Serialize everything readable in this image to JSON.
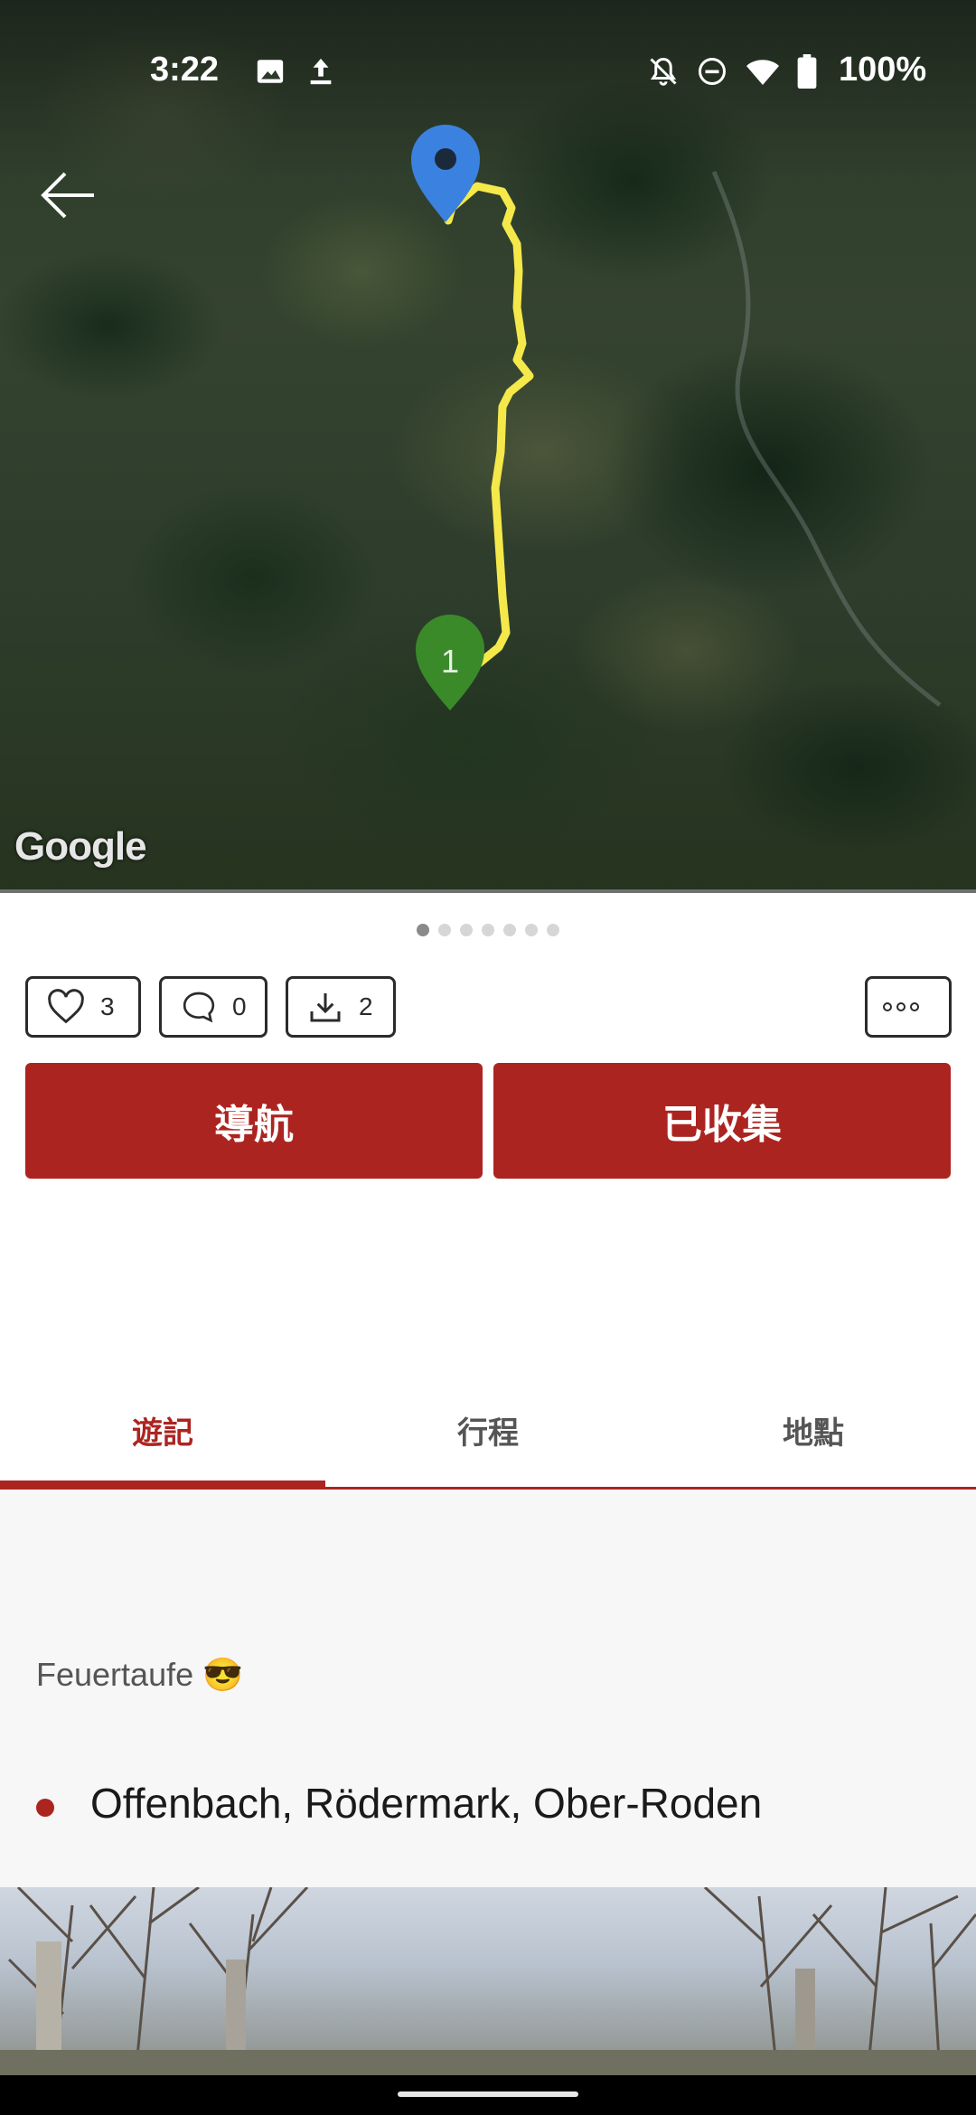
{
  "status_bar": {
    "time": "3:22",
    "battery": "100%",
    "left_icons": [
      "image-icon",
      "upload-icon"
    ],
    "right_icons": [
      "bell-off-icon",
      "do-not-disturb-icon",
      "wifi-icon",
      "battery-icon"
    ]
  },
  "map": {
    "provider": "Google",
    "start_marker_label": "1",
    "route_color": "#f5e84a",
    "start_marker_color": "#3a8a2a",
    "end_marker_color": "#3b82e0"
  },
  "carousel": {
    "count": 7,
    "active": 0
  },
  "actions": {
    "like_count": "3",
    "comment_count": "0",
    "download_count": "2"
  },
  "buttons": {
    "navigate": "導航",
    "saved": "已收集"
  },
  "tabs": [
    {
      "label": "遊記",
      "active": true
    },
    {
      "label": "行程",
      "active": false
    },
    {
      "label": "地點",
      "active": false
    }
  ],
  "content": {
    "title": "Feuertaufe 😎",
    "location": "Offenbach, Rödermark, Ober-Roden"
  },
  "colors": {
    "accent": "#ac2420"
  }
}
